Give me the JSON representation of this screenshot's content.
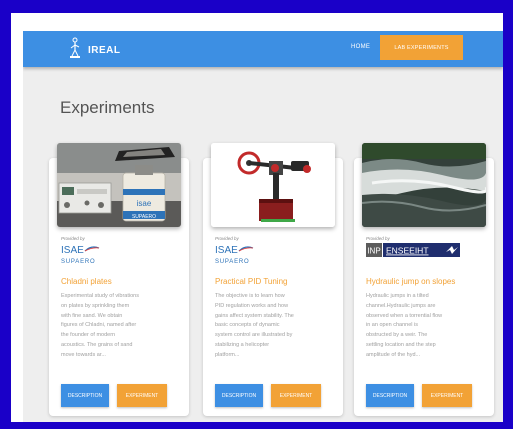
{
  "nav": {
    "brand": "IREAL",
    "home": "HOME",
    "lab_experiments": "LAB EXPERIMENTS"
  },
  "page": {
    "title": "Experiments"
  },
  "cards": [
    {
      "provider_label": "Provided by",
      "provider_logo": "isae-supaero",
      "logo_text": "ISAE",
      "logo_sub": "SUPAERO",
      "title": "Chladni plates",
      "desc_lines": [
        "Experimental study of vibrations",
        "on plates by sprinkling them",
        "with fine sand. We obtain",
        "figures of Chladni, named after",
        "the founder of modern",
        "acoustics. The grains of sand",
        "move towards ar..."
      ],
      "description_button": "DESCRIPTION",
      "experiment_button": "EXPERIMENT"
    },
    {
      "provider_label": "Provided by",
      "provider_logo": "isae-supaero",
      "logo_text": "ISAE",
      "logo_sub": "SUPAERO",
      "title": "Practical PID Tuning",
      "desc_lines": [
        "The objective is to learn how",
        "PID regulation works and how",
        "gains affect system stability. The",
        "basic concepts of dynamic",
        "system control are illustrated by",
        "stabilizing a helicopter",
        "platform..."
      ],
      "description_button": "DESCRIPTION",
      "experiment_button": "EXPERIMENT"
    },
    {
      "provider_label": "Provided by",
      "provider_logo": "inp-enseeiht",
      "logo_text": "INP",
      "logo_sub": "ENSEEIHT",
      "title": "Hydraulic jump on slopes",
      "desc_lines": [
        "Hydraulic jumps in a tilted",
        "channel.Hydraulic jumps are",
        "observed when a torrential flow",
        "in an open channel is",
        "obstructed by a weir. The",
        "settling location and the step",
        "amplitude of the hyd..."
      ],
      "description_button": "DESCRIPTION",
      "experiment_button": "EXPERIMENT"
    }
  ],
  "colors": {
    "primary": "#3d8fe3",
    "accent": "#f2a236",
    "frame": "#1a00c8",
    "background": "#eeeeee"
  },
  "icons": [
    "robot-logo-icon"
  ]
}
